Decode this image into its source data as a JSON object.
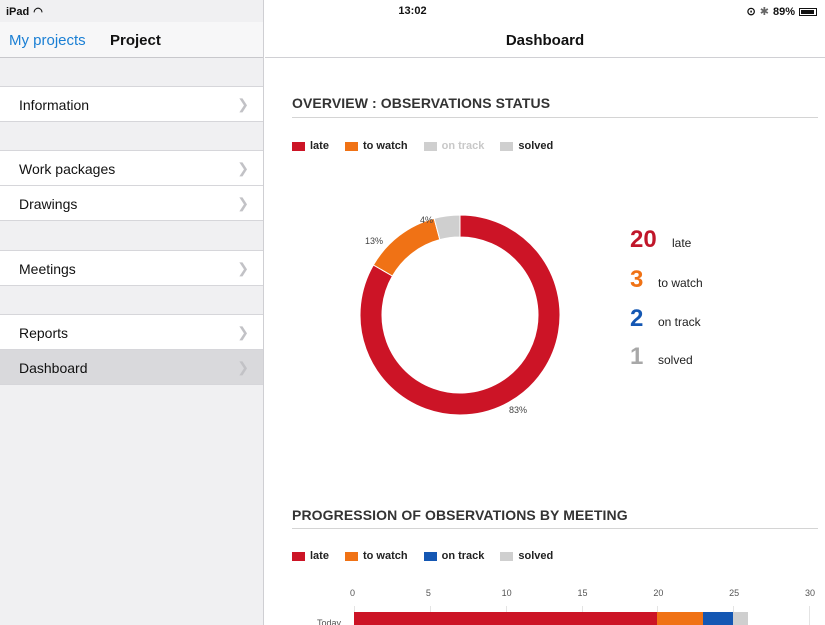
{
  "status_bar": {
    "device": "iPad",
    "time": "13:02",
    "battery": "89%"
  },
  "sidebar": {
    "back_label": "My projects",
    "title": "Project",
    "items": [
      {
        "label": "Information",
        "active": false
      },
      {
        "label": "Work packages",
        "active": false
      },
      {
        "label": "Drawings",
        "active": false
      },
      {
        "label": "Meetings",
        "active": false
      },
      {
        "label": "Reports",
        "active": false
      },
      {
        "label": "Dashboard",
        "active": true
      }
    ]
  },
  "main": {
    "title": "Dashboard",
    "overview": {
      "title": "OVERVIEW : OBSERVATIONS STATUS",
      "legend": [
        {
          "label": "late",
          "color": "#cc1426",
          "muted": false
        },
        {
          "label": "to watch",
          "color": "#f07215",
          "muted": false
        },
        {
          "label": "on track",
          "color": "#cfcfcf",
          "muted": true
        },
        {
          "label": "solved",
          "color": "#cfcfcf",
          "muted": false
        }
      ],
      "stats": [
        {
          "value": "20",
          "label": "late",
          "color": "#c0162a"
        },
        {
          "value": "3",
          "label": "to watch",
          "color": "#f07215"
        },
        {
          "value": "2",
          "label": "on track",
          "color": "#1457b3"
        },
        {
          "value": "1",
          "label": "solved",
          "color": "#a8a8a8"
        }
      ],
      "slice_labels": {
        "late": "83%",
        "to_watch": "13%",
        "solved": "4%"
      }
    },
    "progression": {
      "title": "PROGRESSION OF OBSERVATIONS BY MEETING",
      "legend": [
        {
          "label": "late",
          "color": "#cc1426"
        },
        {
          "label": "to watch",
          "color": "#f07215"
        },
        {
          "label": "on track",
          "color": "#1457b3"
        },
        {
          "label": "solved",
          "color": "#cfcfcf"
        }
      ],
      "row_label": "Today"
    }
  },
  "chart_data": [
    {
      "type": "pie",
      "title": "OVERVIEW : OBSERVATIONS STATUS",
      "categories": [
        "late",
        "to watch",
        "on track",
        "solved"
      ],
      "values": [
        20,
        3,
        0,
        1
      ],
      "data_labels": [
        "83%",
        "13%",
        "",
        "4%"
      ],
      "colors": [
        "#cc1426",
        "#f07215",
        "#cfcfcf",
        "#cfcfcf"
      ],
      "legend": "top-left"
    },
    {
      "type": "bar",
      "orientation": "horizontal",
      "stacked": true,
      "title": "PROGRESSION OF OBSERVATIONS BY MEETING",
      "categories": [
        "Today"
      ],
      "xlim": [
        0,
        30
      ],
      "xticks": [
        0,
        5,
        10,
        15,
        20,
        25,
        30
      ],
      "series": [
        {
          "name": "late",
          "values": [
            20
          ],
          "color": "#cc1426"
        },
        {
          "name": "to watch",
          "values": [
            3
          ],
          "color": "#f07215"
        },
        {
          "name": "on track",
          "values": [
            2
          ],
          "color": "#1457b3"
        },
        {
          "name": "solved",
          "values": [
            1
          ],
          "color": "#cfcfcf"
        }
      ],
      "grid": true,
      "legend": "top-left"
    }
  ]
}
